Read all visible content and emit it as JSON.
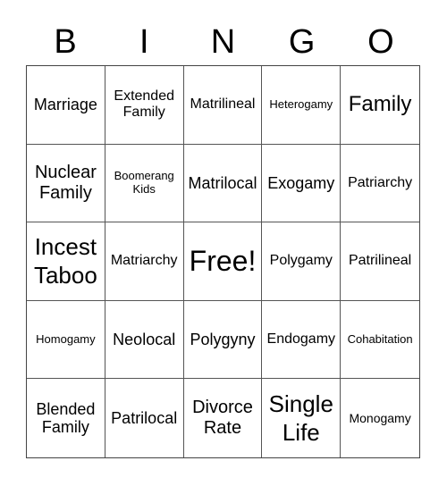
{
  "header": {
    "letters": [
      "B",
      "I",
      "N",
      "G",
      "O"
    ]
  },
  "cells": [
    "Marriage",
    "Extended Family",
    "Matrilineal",
    "Heterogamy",
    "Family",
    "Nuclear Family",
    "Boomerang Kids",
    "Matrilocal",
    "Exogamy",
    "Patriarchy",
    "Incest Taboo",
    "Matriarchy",
    "Free!",
    "Polygamy",
    "Patrilineal",
    "Homogamy",
    "Neolocal",
    "Polygyny",
    "Endogamy",
    "Cohabitation",
    "Blended Family",
    "Patrilocal",
    "Divorce Rate",
    "Single Life",
    "Monogamy"
  ]
}
